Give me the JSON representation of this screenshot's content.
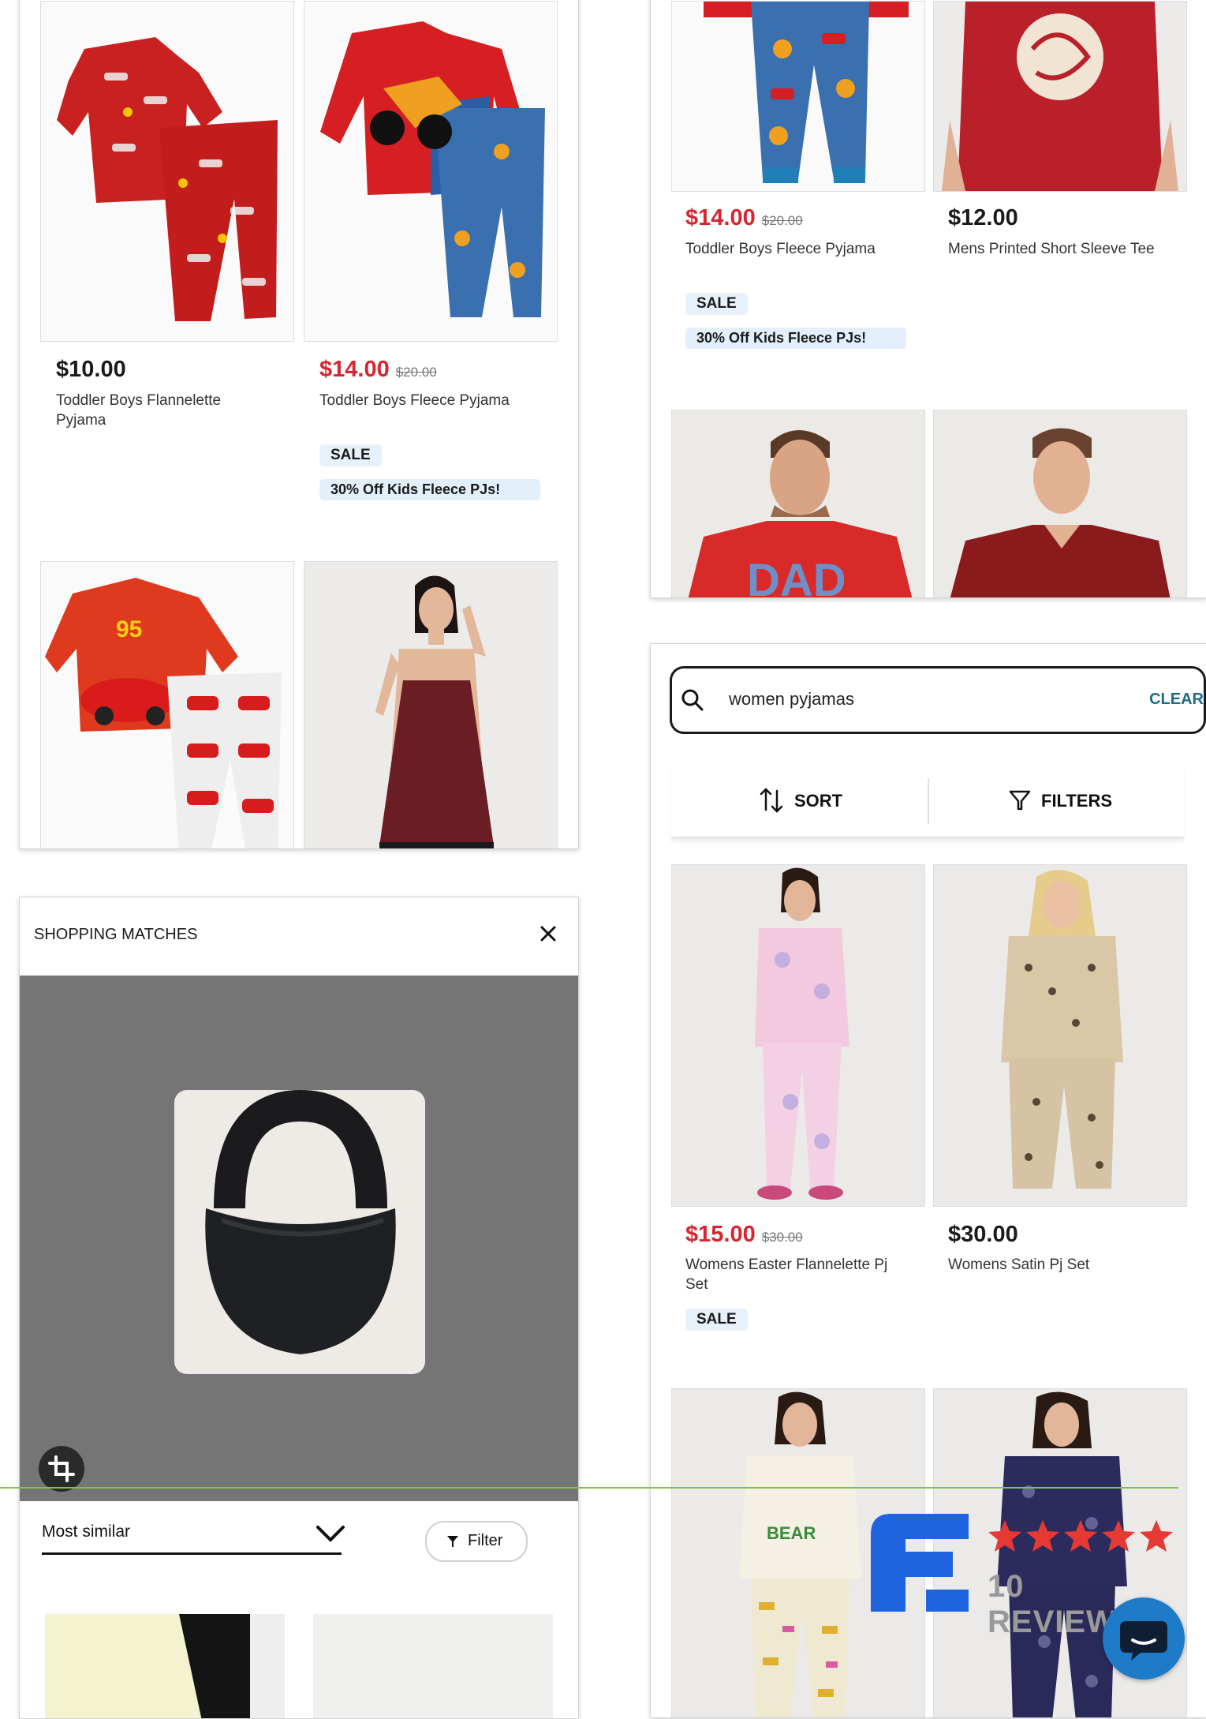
{
  "card1": {
    "products": [
      {
        "price": "$10.00",
        "was": "",
        "name": "Toddler Boys Flannelette Pyjama"
      },
      {
        "price": "$14.00",
        "was": "$20.00",
        "name": "Toddler Boys Fleece Pyjama",
        "badge": "SALE",
        "promo": "30% Off Kids Fleece PJs!"
      }
    ],
    "art": {
      "lightning_number": "95"
    }
  },
  "card2": {
    "products": [
      {
        "price": "$14.00",
        "was": "$20.00",
        "name": "Toddler Boys Fleece Pyjama",
        "badge": "SALE",
        "promo": "30% Off Kids Fleece PJs!"
      },
      {
        "price": "$12.00",
        "was": "",
        "name": "Mens Printed Short Sleeve Tee"
      }
    ],
    "art": {
      "dad_text": "DAD"
    }
  },
  "shopping": {
    "title": "SHOPPING MATCHES",
    "sort_value": "Most similar",
    "filter_label": "Filter"
  },
  "search": {
    "query": "women pyjamas",
    "clear_label": "CLEAR",
    "sort_label": "SORT",
    "filters_label": "FILTERS",
    "products": [
      {
        "price": "$15.00",
        "was": "$30.00",
        "name": "Womens Easter Flannelette Pj Set",
        "badge": "SALE"
      },
      {
        "price": "$30.00",
        "was": "",
        "name": "Womens Satin Pj Set"
      }
    ],
    "art": {
      "shirt_text": "BEAR"
    }
  },
  "reviews": {
    "count_label": "10 REVIEWS",
    "stars": 5
  },
  "colors": {
    "sale_red": "#d7262f",
    "brand_blue": "#1e63e0",
    "chat_blue": "#1d7bc8",
    "star_red": "#e53935",
    "panel_gray": "#757575"
  }
}
